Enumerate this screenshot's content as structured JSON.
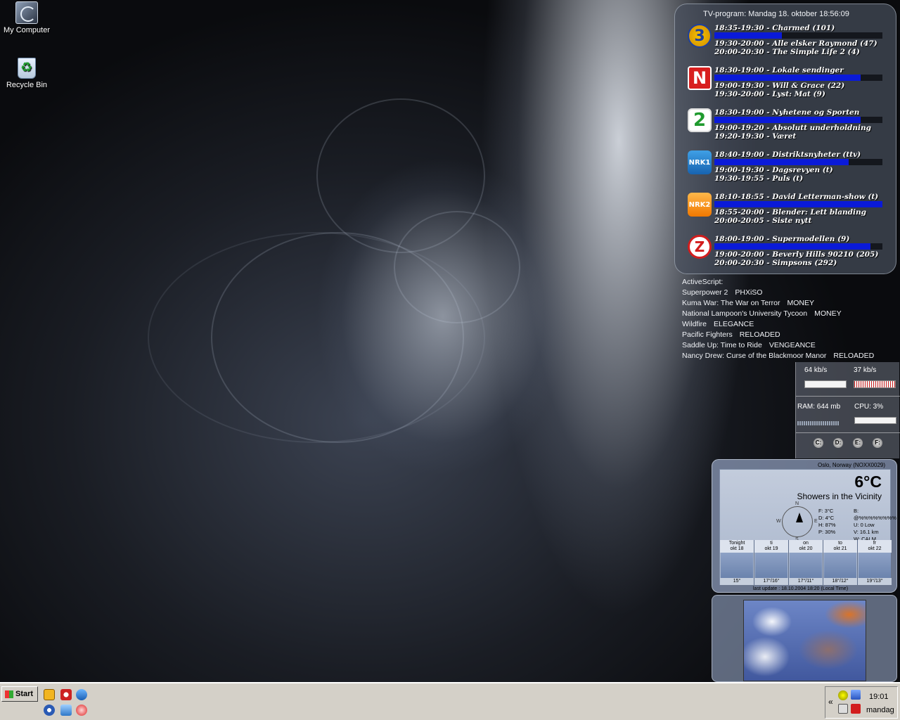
{
  "desktop": {
    "icons": [
      {
        "label": "My Computer"
      },
      {
        "label": "Recycle Bin"
      }
    ]
  },
  "tv": {
    "title": "TV-program: Mandag 18. oktober 18:56:09",
    "channels": [
      {
        "logo": "3",
        "now": "18:35-19:30 - Charmed (101)",
        "progress": 0.4,
        "next1": "19:30-20:00 - Alle elsker Raymond (47)",
        "next2": "20:00-20:30 - The Simple Life 2 (4)"
      },
      {
        "logo": "N",
        "now": "18:30-19:00 - Lokale sendinger",
        "progress": 0.87,
        "next1": "19:00-19:30 - Will & Grace (22)",
        "next2": "19:30-20:00 - Lyst: Mat (9)"
      },
      {
        "logo": "2",
        "now": "18:30-19:00 - Nyhetene og Sporten",
        "progress": 0.87,
        "next1": "19:00-19:20 - Absolutt underholdning",
        "next2": "19:20-19:30 - Været"
      },
      {
        "logo": "NRK1",
        "now": "18:40-19:00 - Distriktsnyheter (ttv)",
        "progress": 0.8,
        "next1": "19:00-19:30 - Dagsrevyen (t)",
        "next2": "19:30-19:55 - Puls (t)"
      },
      {
        "logo": "NRK2",
        "now": "18:10-18:55 - David Letterman-show (t)",
        "progress": 1.0,
        "next1": "18:55-20:00 - Blender: Lett blanding",
        "next2": "20:00-20:05 - Siste nytt"
      },
      {
        "logo": "Z",
        "now": "18:00-19:00 - Supermodellen (9)",
        "progress": 0.93,
        "next1": "19:00-20:00 - Beverly Hills 90210 (205)",
        "next2": "20:00-20:30 - Simpsons (292)"
      }
    ]
  },
  "activescript": {
    "heading": "ActiveScript:",
    "items": [
      {
        "title": "Superpower 2",
        "group": "PHXiSO"
      },
      {
        "title": "Kuma War: The War on Terror",
        "group": "MONEY"
      },
      {
        "title": "National Lampoon's University Tycoon",
        "group": "MONEY"
      },
      {
        "title": "Wildfire",
        "group": "ELEGANCE"
      },
      {
        "title": "Pacific Fighters",
        "group": "RELOADED"
      },
      {
        "title": "Saddle Up: Time to Ride",
        "group": "VENGEANCE"
      },
      {
        "title": "Nancy Drew: Curse of the Blackmoor Manor",
        "group": "RELOADED"
      }
    ]
  },
  "system": {
    "download": "64 kb/s",
    "upload": "37 kb/s",
    "ram": "RAM: 644 mb",
    "cpu": "CPU: 3%",
    "drives": [
      "C:",
      "D:",
      "E:",
      "F:"
    ]
  },
  "weather": {
    "location": "Oslo, Norway (NOXX0029)",
    "temp": "6°C",
    "condition": "Showers in the Vicinity",
    "compass": {
      "n": "N",
      "e": "E",
      "s": "S",
      "w": "W"
    },
    "stats_left": [
      "F:  3°C",
      "D:  4°C",
      "H:  87%",
      "P:  30%"
    ],
    "stats_right": [
      "B:  @%%%%%%%%",
      "U:  0 Low",
      "V:  16.1 km",
      "W:  CALM"
    ],
    "days": [
      {
        "label": "Tonight",
        "date": "okt 18",
        "temp": "15°"
      },
      {
        "label": "ti",
        "date": "okt 19",
        "temp": "17°/16°"
      },
      {
        "label": "on",
        "date": "okt 20",
        "temp": "17°/11°"
      },
      {
        "label": "to",
        "date": "okt 21",
        "temp": "18°/12°"
      },
      {
        "label": "fr",
        "date": "okt 22",
        "temp": "19°/13°"
      }
    ],
    "last_update": "last update : 18.10.2004 18:20 (Local Time)"
  },
  "taskbar": {
    "start_label": "Start",
    "time": "19:01",
    "day": "mandag",
    "chevron": "«"
  }
}
